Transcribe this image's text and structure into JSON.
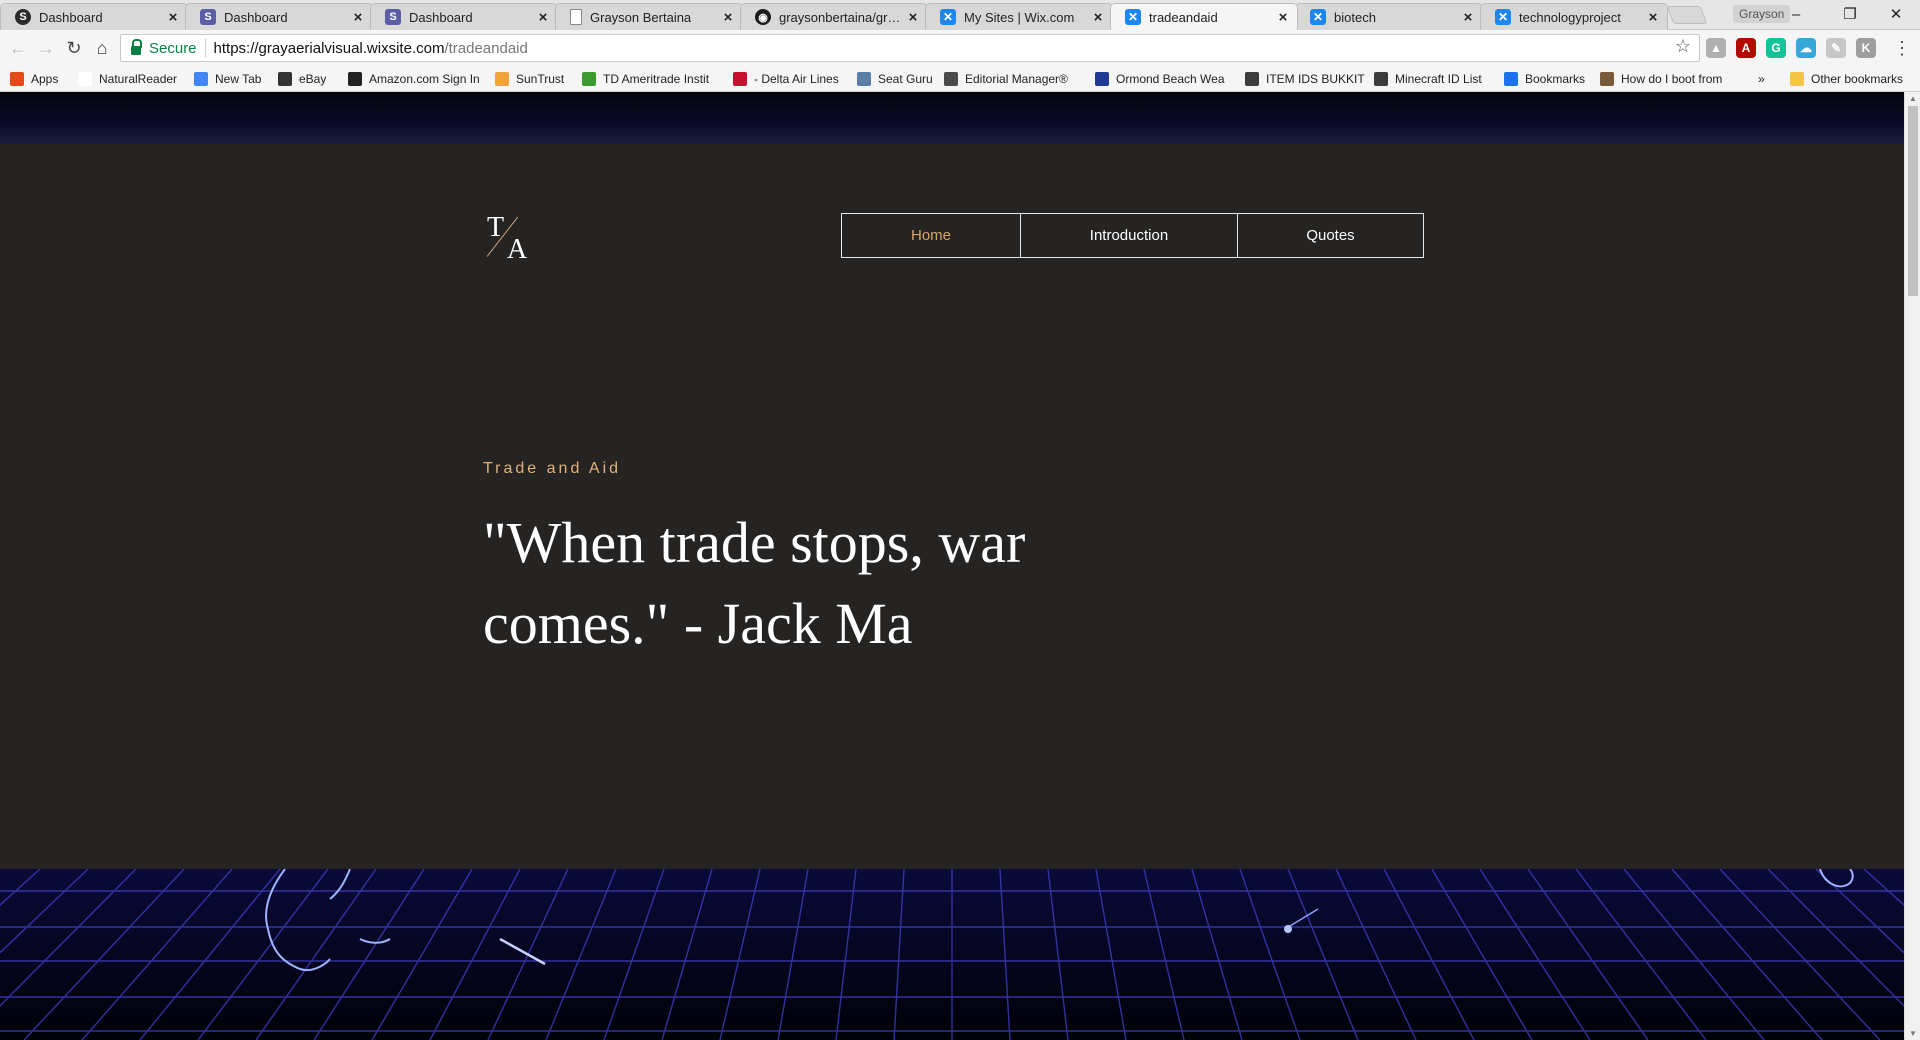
{
  "browser": {
    "tabs": [
      {
        "title": "Dashboard",
        "icon": "dark-logo-icon",
        "active": false
      },
      {
        "title": "Dashboard",
        "icon": "s-logo-icon",
        "active": false
      },
      {
        "title": "Dashboard",
        "icon": "s-logo-icon",
        "active": false
      },
      {
        "title": "Grayson Bertaina",
        "icon": "document-icon",
        "active": false
      },
      {
        "title": "graysonbertaina/grayso",
        "icon": "github-icon",
        "active": false
      },
      {
        "title": "My Sites | Wix.com",
        "icon": "wix-icon",
        "active": false
      },
      {
        "title": "tradeandaid",
        "icon": "wix-icon",
        "active": true
      },
      {
        "title": "biotech",
        "icon": "wix-icon",
        "active": false
      },
      {
        "title": "technologyproject",
        "icon": "wix-icon",
        "active": false
      }
    ],
    "close_glyph": "×",
    "profile_name": "Grayson",
    "window_controls": {
      "minimize": "–",
      "restore": "❐",
      "close": "✕"
    },
    "nav": {
      "back": "←",
      "forward": "→",
      "reload": "↻",
      "home": "⌂"
    },
    "address": {
      "secure_label": "Secure",
      "url_host": "https://grayaerialvisual.wixsite.com",
      "url_path": "/tradeandaid",
      "star": "☆"
    },
    "extensions": [
      {
        "name": "drive-icon",
        "glyph": "▲",
        "color": "#b0b0b0"
      },
      {
        "name": "pdf-icon",
        "glyph": "A",
        "color": "#b30b00"
      },
      {
        "name": "grammarly-icon",
        "glyph": "G",
        "color": "#15c39a"
      },
      {
        "name": "cloud-icon",
        "glyph": "☁",
        "color": "#35a7d8"
      },
      {
        "name": "extension-icon",
        "glyph": "✎",
        "color": "#c7c7c7"
      },
      {
        "name": "k-extension-icon",
        "glyph": "K",
        "color": "#9e9e9e"
      }
    ],
    "menu_glyph": "⋮",
    "bookmarks": [
      {
        "label": "Apps",
        "icon": "apps-grid-icon",
        "color": "#e64a19"
      },
      {
        "label": "NaturalReader",
        "icon": "page-icon",
        "color": "#ffffff"
      },
      {
        "label": "New Tab",
        "icon": "google-icon",
        "color": "#4285f4"
      },
      {
        "label": "eBay",
        "icon": "ebay-icon",
        "color": "#333333"
      },
      {
        "label": "Amazon.com Sign In",
        "icon": "amazon-icon",
        "color": "#222222"
      },
      {
        "label": "SunTrust",
        "icon": "suntrust-icon",
        "color": "#f2a23a"
      },
      {
        "label": "TD Ameritrade Instit",
        "icon": "td-icon",
        "color": "#3a9b2e"
      },
      {
        "label": "- Delta Air Lines",
        "icon": "delta-icon",
        "color": "#c8102e"
      },
      {
        "label": "Seat Guru",
        "icon": "seatguru-icon",
        "color": "#5a7da3"
      },
      {
        "label": "Editorial Manager®",
        "icon": "editorial-icon",
        "color": "#4a4a4a"
      },
      {
        "label": "Ormond Beach Wea",
        "icon": "weather-icon",
        "color": "#1f3a93"
      },
      {
        "label": "ITEM IDS BUKKIT",
        "icon": "minecraft-block-icon",
        "color": "#3c3c3c"
      },
      {
        "label": "Minecraft ID List",
        "icon": "minecraft-block-icon",
        "color": "#3c3c3c"
      },
      {
        "label": "Bookmarks",
        "icon": "star-icon",
        "color": "#1a73e8"
      },
      {
        "label": "How do I boot from",
        "icon": "avatar-icon",
        "color": "#7a5a3a"
      }
    ],
    "overflow": "»",
    "other_bookmarks": "Other bookmarks"
  },
  "site": {
    "logo": {
      "top": "T",
      "bottom": "A"
    },
    "nav": [
      {
        "label": "Home",
        "active": true
      },
      {
        "label": "Introduction",
        "active": false
      },
      {
        "label": "Quotes",
        "active": false
      }
    ],
    "eyebrow": "Trade and Aid",
    "headline": "\"When trade stops, war comes.\" - Jack Ma"
  }
}
